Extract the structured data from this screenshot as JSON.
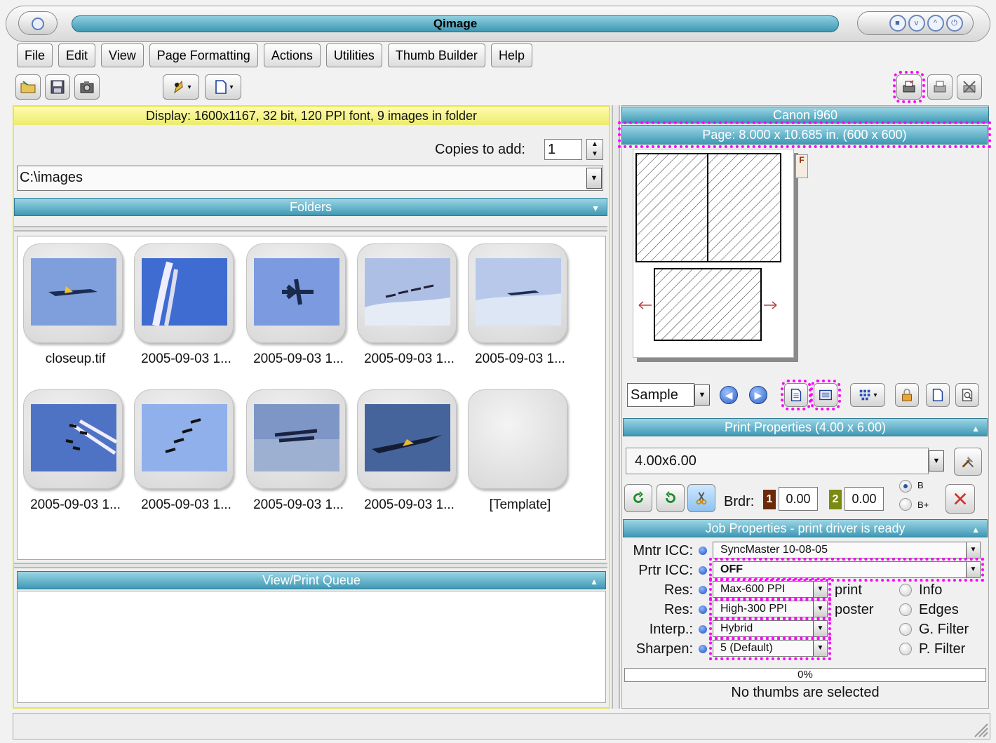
{
  "window": {
    "title": "Qimage"
  },
  "menu": [
    "File",
    "Edit",
    "View",
    "Page Formatting",
    "Actions",
    "Utilities",
    "Thumb Builder",
    "Help"
  ],
  "left": {
    "display_info": "Display: 1600x1167, 32 bit, 120 PPI font, 9 images in folder",
    "copies_label": "Copies to add:",
    "copies_value": "1",
    "path": "C:\\images",
    "folders_header": "Folders",
    "thumbs": [
      {
        "label": "closeup.tif"
      },
      {
        "label": "2005-09-03 1..."
      },
      {
        "label": "2005-09-03 1..."
      },
      {
        "label": "2005-09-03 1..."
      },
      {
        "label": "2005-09-03 1..."
      },
      {
        "label": "2005-09-03 1..."
      },
      {
        "label": "2005-09-03 1..."
      },
      {
        "label": "2005-09-03 1..."
      },
      {
        "label": "2005-09-03 1..."
      },
      {
        "label": "[Template]"
      }
    ],
    "queue_header": "View/Print Queue"
  },
  "right": {
    "printer": "Canon i960",
    "page_info": "Page: 8.000 x 10.685 in.  (600 x 600)",
    "f_tag": "F",
    "sample_label": "Sample",
    "print_props_header": "Print Properties (4.00 x 6.00)",
    "size_value": "4.00x6.00",
    "border_label": "Brdr:",
    "border1_tag": "1",
    "border1_value": "0.00",
    "border2_tag": "2",
    "border2_value": "0.00",
    "radio_b": "B",
    "radio_bplus": "B+",
    "job_props_header": "Job Properties - print driver is ready",
    "props": [
      {
        "label": "Mntr ICC:",
        "value": "SyncMaster 10-08-05"
      },
      {
        "label": "Prtr ICC:",
        "value": "OFF"
      },
      {
        "label": "Res:",
        "value": "Max-600 PPI",
        "side": "print"
      },
      {
        "label": "Res:",
        "value": "High-300 PPI",
        "side": "poster"
      },
      {
        "label": "Interp.:",
        "value": "Hybrid"
      },
      {
        "label": "Sharpen:",
        "value": "5 (Default)"
      }
    ],
    "checks": [
      "Info",
      "Edges",
      "G. Filter",
      "P. Filter"
    ],
    "progress": "0%",
    "status": "No thumbs are selected"
  },
  "colors": {
    "accent_blue": "#3f98b4",
    "display_yellow": "#ecec6c",
    "highlight": "#ff00ff"
  }
}
